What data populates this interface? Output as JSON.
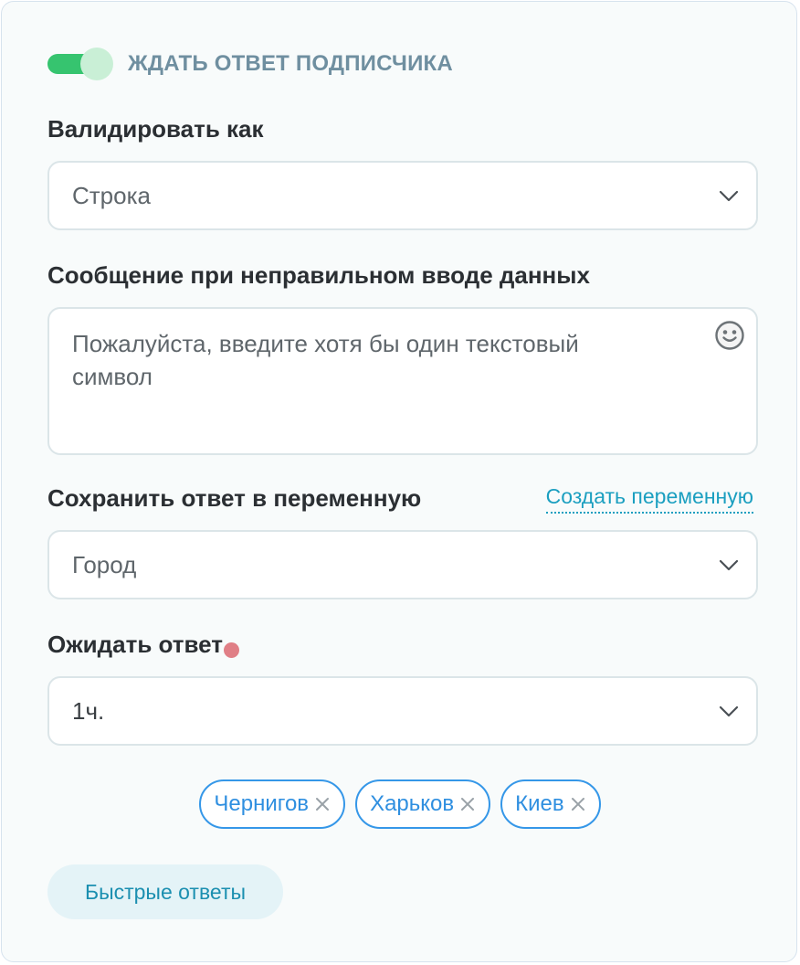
{
  "toggle": {
    "label": "ЖДАТЬ ОТВЕТ ПОДПИСЧИКА",
    "enabled": true
  },
  "validate": {
    "label": "Валидировать как",
    "value": "Строка"
  },
  "error_message": {
    "label": "Сообщение при неправильном вводе данных",
    "text": "Пожалуйста, введите хотя бы один текстовый символ"
  },
  "save_variable": {
    "label": "Сохранить ответ в переменную",
    "create_link": "Создать переменную",
    "value": "Город"
  },
  "wait": {
    "label": "Ожидать ответ",
    "value": "1ч."
  },
  "chips": [
    "Чернигов",
    "Харьков",
    "Киев"
  ],
  "quick_replies_button": "Быстрые ответы",
  "colors": {
    "toggle_on": "#36c46f",
    "accent_link": "#1b9fc0",
    "chip_border": "#3597e8",
    "required_dot": "#e07f86"
  }
}
